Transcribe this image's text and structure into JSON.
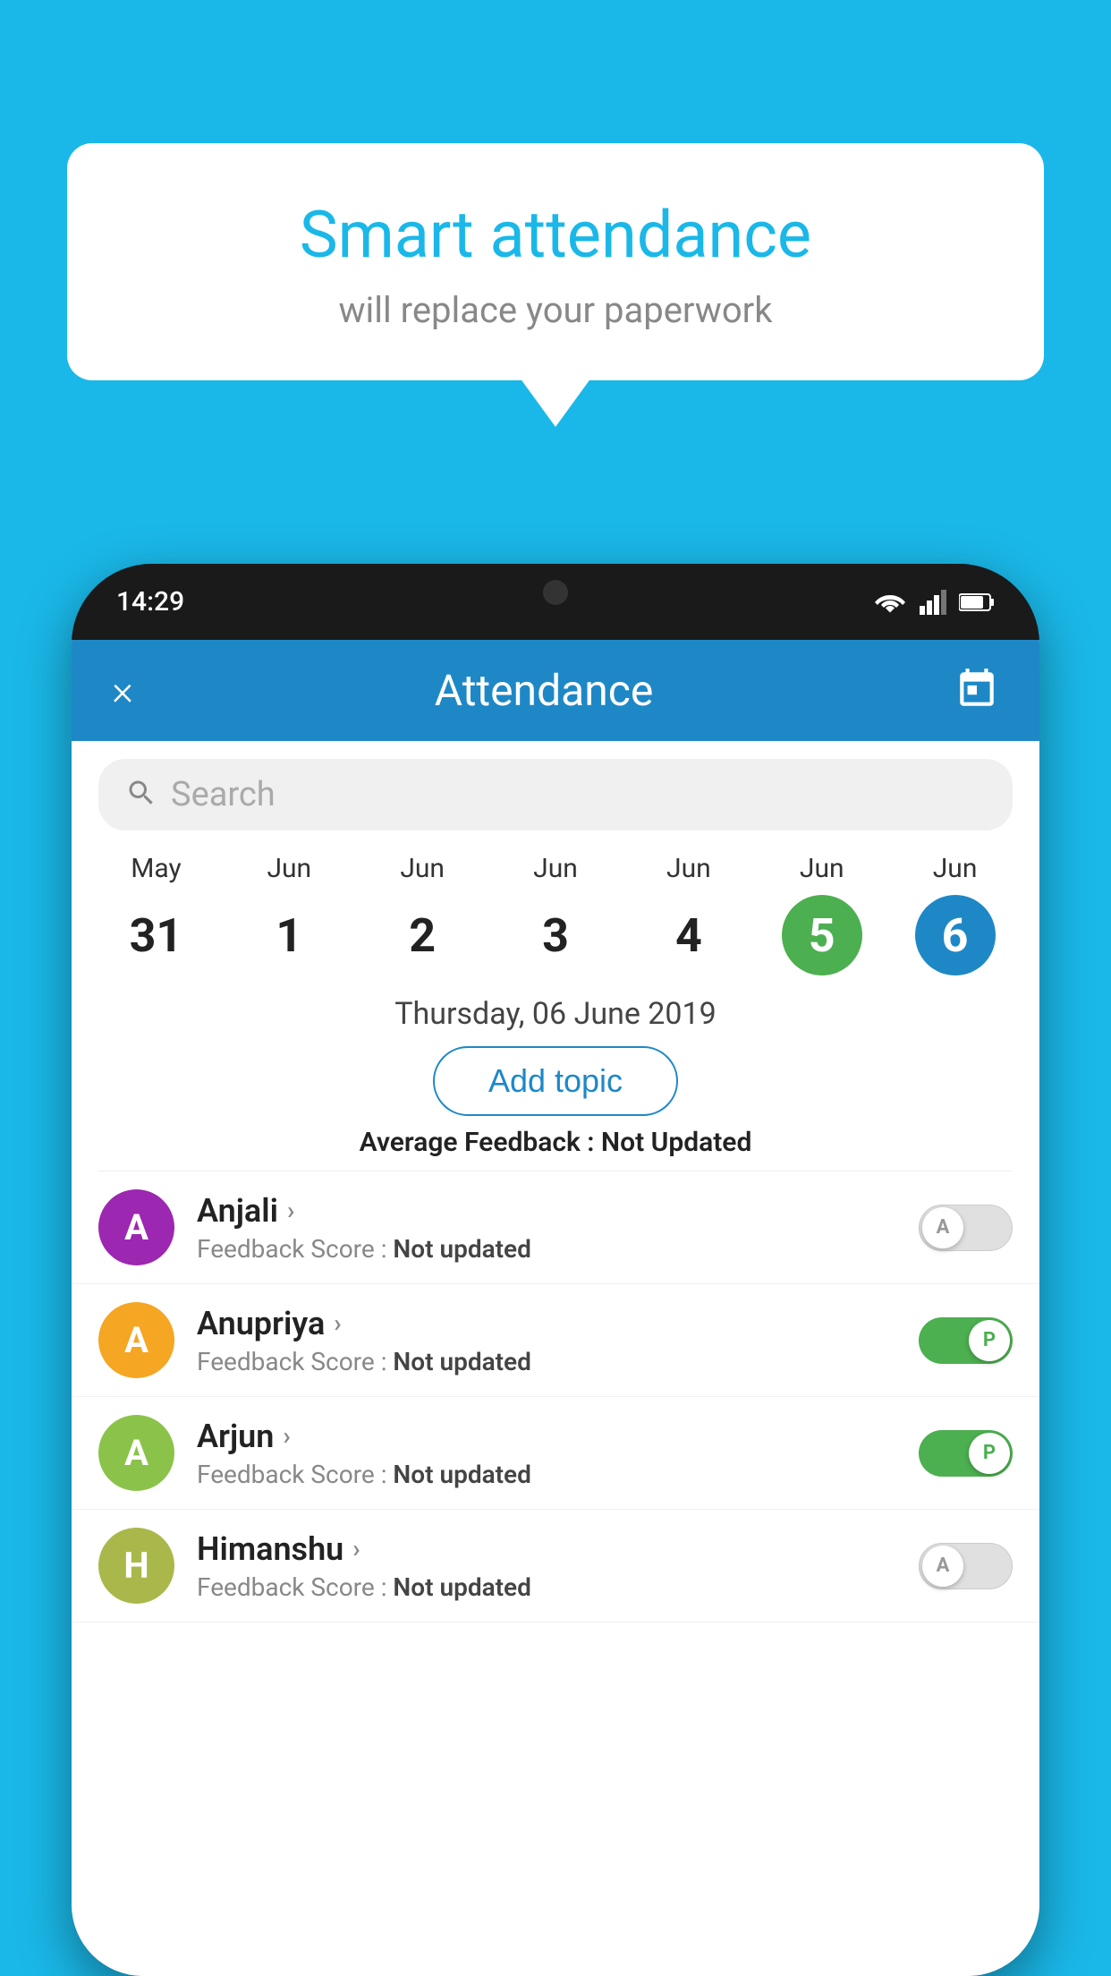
{
  "background_color": "#1ab8e8",
  "speech_bubble": {
    "title": "Smart attendance",
    "subtitle": "will replace your paperwork"
  },
  "status_bar": {
    "time": "14:29"
  },
  "app_header": {
    "title": "Attendance",
    "close_label": "×"
  },
  "search": {
    "placeholder": "Search"
  },
  "calendar": {
    "days": [
      {
        "month": "May",
        "day": "31",
        "state": "normal"
      },
      {
        "month": "Jun",
        "day": "1",
        "state": "normal"
      },
      {
        "month": "Jun",
        "day": "2",
        "state": "normal"
      },
      {
        "month": "Jun",
        "day": "3",
        "state": "normal"
      },
      {
        "month": "Jun",
        "day": "4",
        "state": "normal"
      },
      {
        "month": "Jun",
        "day": "5",
        "state": "today"
      },
      {
        "month": "Jun",
        "day": "6",
        "state": "selected"
      }
    ]
  },
  "selected_date": "Thursday, 06 June 2019",
  "add_topic_label": "Add topic",
  "average_feedback_label": "Average Feedback :",
  "average_feedback_value": "Not Updated",
  "students": [
    {
      "name": "Anjali",
      "initial": "A",
      "avatar_color": "#9c27b0",
      "feedback_label": "Feedback Score :",
      "feedback_value": "Not updated",
      "toggle_state": "off",
      "toggle_label": "A"
    },
    {
      "name": "Anupriya",
      "initial": "A",
      "avatar_color": "#f5a623",
      "feedback_label": "Feedback Score :",
      "feedback_value": "Not updated",
      "toggle_state": "on",
      "toggle_label": "P"
    },
    {
      "name": "Arjun",
      "initial": "A",
      "avatar_color": "#8bc34a",
      "feedback_label": "Feedback Score :",
      "feedback_value": "Not updated",
      "toggle_state": "on",
      "toggle_label": "P"
    },
    {
      "name": "Himanshu",
      "initial": "H",
      "avatar_color": "#aab84b",
      "feedback_label": "Feedback Score :",
      "feedback_value": "Not updated",
      "toggle_state": "off",
      "toggle_label": "A"
    }
  ]
}
